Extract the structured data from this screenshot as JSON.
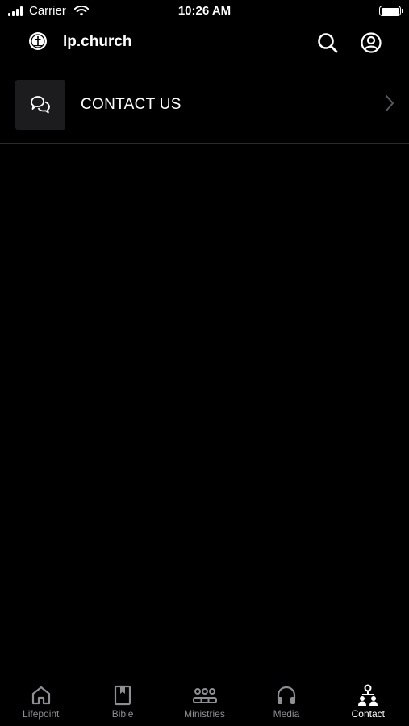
{
  "status_bar": {
    "carrier": "Carrier",
    "time": "10:26 AM"
  },
  "header": {
    "title": "lp.church",
    "logo_icon": "church-logo-icon",
    "search_icon": "search-icon",
    "profile_icon": "user-circle-icon"
  },
  "contact": {
    "label": "CONTACT US",
    "icon": "chat-bubbles-icon"
  },
  "tabs": [
    {
      "label": "Lifepoint",
      "icon": "home-icon",
      "active": false
    },
    {
      "label": "Bible",
      "icon": "book-icon",
      "active": false
    },
    {
      "label": "Ministries",
      "icon": "people-group-icon",
      "active": false
    },
    {
      "label": "Media",
      "icon": "headphones-icon",
      "active": false
    },
    {
      "label": "Contact",
      "icon": "contact-org-icon",
      "active": true
    }
  ],
  "colors": {
    "background": "#000000",
    "text": "#ffffff",
    "inactive_tab": "#8e8e93",
    "icon_box": "#1c1c1e"
  }
}
